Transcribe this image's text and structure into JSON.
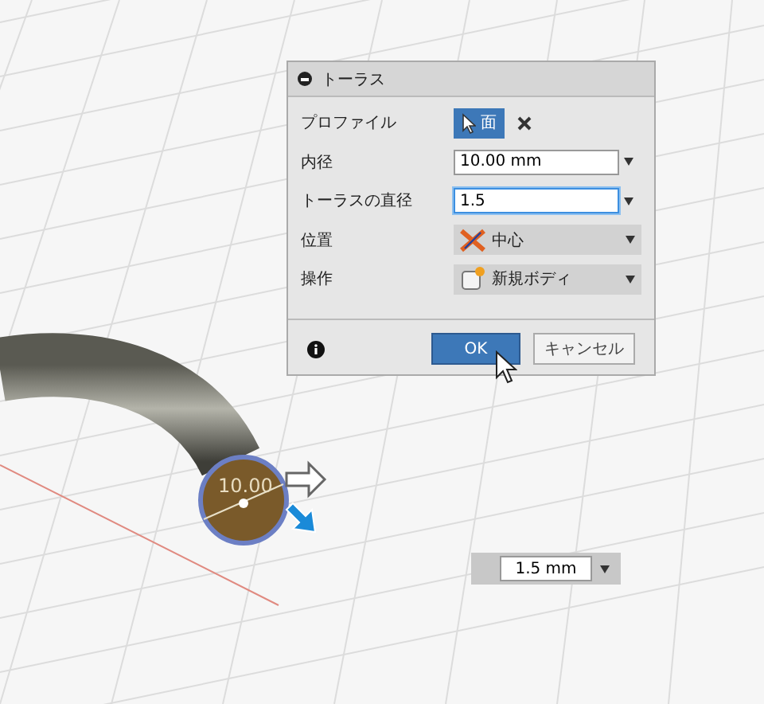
{
  "dialog": {
    "title": "トーラス",
    "rows": [
      {
        "kind": "selection",
        "label": "プロファイル",
        "value": "面",
        "selected": true
      },
      {
        "kind": "input",
        "label": "内径",
        "value": "10.00 mm",
        "focused": false
      },
      {
        "kind": "input",
        "label": "トーラスの直径",
        "value": "1.5",
        "focused": true
      },
      {
        "kind": "dropdown",
        "label": "位置",
        "value": "中心"
      },
      {
        "kind": "dropdown",
        "label": "操作",
        "value": "新規ボディ"
      }
    ],
    "buttons": [
      {
        "kind": "primary",
        "label": "OK"
      },
      {
        "kind": "secondary",
        "label": "キャンセル"
      }
    ]
  },
  "canvas": {
    "dimension_label": "10.00",
    "value_input": "1.5 mm"
  }
}
